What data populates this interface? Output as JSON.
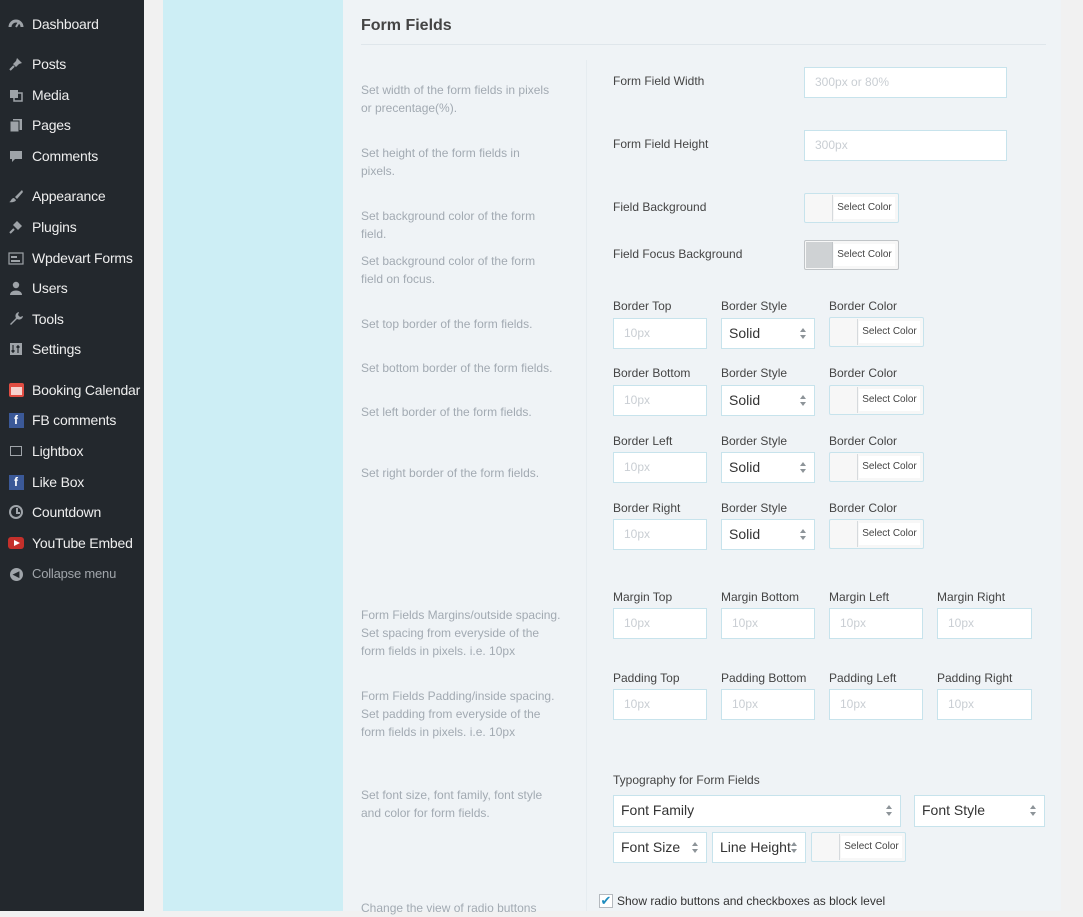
{
  "sidebar": {
    "items": [
      {
        "label": "Dashboard",
        "icon": "dashboard-icon"
      },
      {
        "label": "Posts",
        "icon": "pushpin-icon"
      },
      {
        "label": "Media",
        "icon": "media-icon"
      },
      {
        "label": "Pages",
        "icon": "pages-icon"
      },
      {
        "label": "Comments",
        "icon": "comment-icon"
      },
      {
        "label": "Appearance",
        "icon": "paintbrush-icon"
      },
      {
        "label": "Plugins",
        "icon": "plug-icon"
      },
      {
        "label": "Wpdevart Forms",
        "icon": "forms-icon"
      },
      {
        "label": "Users",
        "icon": "user-icon"
      },
      {
        "label": "Tools",
        "icon": "wrench-icon"
      },
      {
        "label": "Settings",
        "icon": "settings-icon"
      },
      {
        "label": "Booking Calendar",
        "icon": "calendar-icon"
      },
      {
        "label": "FB comments",
        "icon": "facebook-icon"
      },
      {
        "label": "Lightbox",
        "icon": "lightbox-icon"
      },
      {
        "label": "Like Box",
        "icon": "facebook-icon"
      },
      {
        "label": "Countdown",
        "icon": "clock-icon"
      },
      {
        "label": "YouTube Embed",
        "icon": "youtube-icon"
      },
      {
        "label": "Collapse menu",
        "icon": "collapse-icon"
      }
    ]
  },
  "section": {
    "title": "Form Fields"
  },
  "descriptions": {
    "width": "Set width of the form fields in pixels or precentage(%).",
    "height": "Set height of the form fields in pixels.",
    "background": "Set background color of the form field.",
    "focus_background": "Set background color of the form field on focus.",
    "border_top": "Set top border of the form fields.",
    "border_bottom": "Set bottom border of the form fields.",
    "border_left": "Set left border of the form fields.",
    "border_right": "Set right border of the form fields.",
    "margins": "Form Fields Margins/outside spacing. Set spacing from everyside of the form fields in pixels. i.e. 10px",
    "padding": "Form Fields Padding/inside spacing. Set padding from everyside of the form fields in pixels. i.e. 10px",
    "typography": "Set font size, font family, font style and color for form fields.",
    "radio_view": "Change the view of radio buttons"
  },
  "fields": {
    "width": {
      "label": "Form Field Width",
      "placeholder": "300px or 80%"
    },
    "height": {
      "label": "Form Field Height",
      "placeholder": "300px"
    },
    "background": {
      "label": "Field Background"
    },
    "focus_background": {
      "label": "Field Focus Background"
    }
  },
  "color_picker": {
    "button_label": "Select Color"
  },
  "borders": {
    "style_label": "Border Style",
    "color_label": "Border Color",
    "size_placeholder": "10px",
    "rows": [
      {
        "label": "Border Top",
        "style": "Solid"
      },
      {
        "label": "Border Bottom",
        "style": "Solid"
      },
      {
        "label": "Border Left",
        "style": "Solid"
      },
      {
        "label": "Border Right",
        "style": "Solid"
      }
    ]
  },
  "margins": {
    "placeholder": "10px",
    "labels": [
      "Margin Top",
      "Margin Bottom",
      "Margin Left",
      "Margin Right"
    ]
  },
  "padding": {
    "placeholder": "10px",
    "labels": [
      "Padding Top",
      "Padding Bottom",
      "Padding Left",
      "Padding Right"
    ]
  },
  "typography": {
    "label": "Typography for Form Fields",
    "font_family": "Font Family",
    "font_style": "Font Style",
    "font_size": "Font Size",
    "line_height": "Line Height"
  },
  "radio_block": {
    "label": "Show radio buttons and checkboxes as block level",
    "checked": true
  }
}
